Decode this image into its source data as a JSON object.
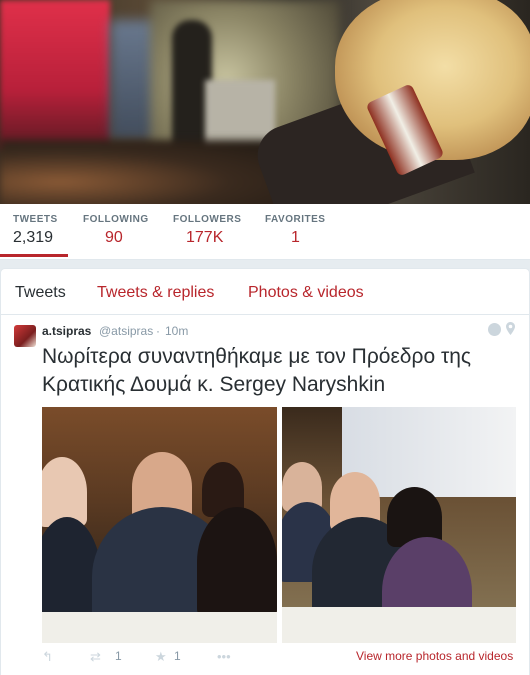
{
  "stats": [
    {
      "label": "TWEETS",
      "value": "2,319"
    },
    {
      "label": "FOLLOWING",
      "value": "90"
    },
    {
      "label": "FOLLOWERS",
      "value": "177K"
    },
    {
      "label": "FAVORITES",
      "value": "1"
    }
  ],
  "tabs": [
    "Tweets",
    "Tweets & replies",
    "Photos & videos"
  ],
  "tweet": {
    "name": "a.tsipras",
    "handle": "@atsipras",
    "separator": "·",
    "time": "10m",
    "text": "Νωρίτερα συναντηθήκαμε με τον Πρόεδρο της Κρατικής Δουμά κ. Sergey Naryshkin",
    "retweet_count": "1",
    "favorite_count": "1",
    "reply_icon": "↰",
    "retweet_icon": "⇄",
    "favorite_icon": "★",
    "more_icon": "•••",
    "view_more_label": "View more photos and videos"
  },
  "colors": {
    "accent": "#b8262c",
    "text": "#292f33",
    "muted": "#66757f",
    "background": "#e6ecf0"
  }
}
